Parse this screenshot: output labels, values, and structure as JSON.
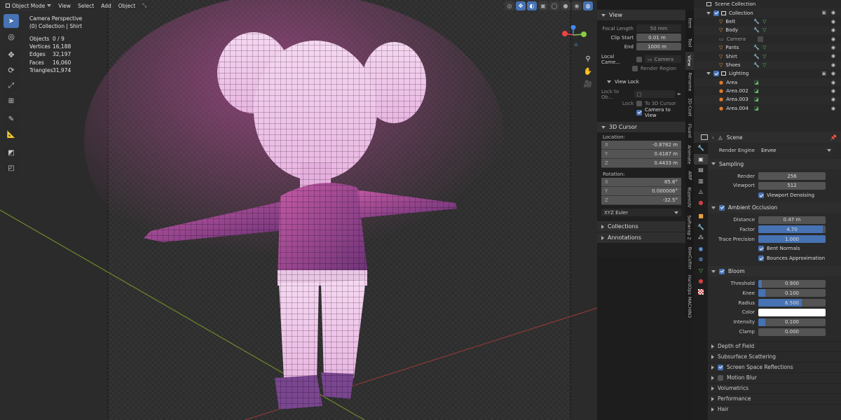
{
  "viewport": {
    "mode_label": "Object Mode",
    "menu": [
      "View",
      "Select",
      "Add",
      "Object"
    ],
    "overlay_title": "Camera Perspective",
    "overlay_collection": "(0) Collection | Shirt",
    "stats": [
      {
        "label": "Objects",
        "value": "0 / 9"
      },
      {
        "label": "Vertices",
        "value": "16,188"
      },
      {
        "label": "Edges",
        "value": "32,197"
      },
      {
        "label": "Faces",
        "value": "16,060"
      },
      {
        "label": "Triangles",
        "value": "31,974"
      }
    ]
  },
  "npanel": {
    "view_title": "View",
    "focal_length_label": "Focal Length",
    "focal_length_value": "50 mm",
    "clip_start_label": "Clip Start",
    "clip_start_value": "0.01 m",
    "clip_end_label": "End",
    "clip_end_value": "1000 m",
    "local_camera_label": "Local Came...",
    "local_camera_value": "Camera",
    "render_region_label": "Render Region",
    "view_lock_title": "View Lock",
    "lock_to_obj_label": "Lock to Ob...",
    "lock_label": "Lock",
    "to_3d_cursor_label": "To 3D Cursor",
    "camera_to_view_label": "Camera to View",
    "cursor_title": "3D Cursor",
    "location_label": "Location:",
    "location": [
      {
        "axis": "X",
        "value": "-0.8782 m"
      },
      {
        "axis": "Y",
        "value": "0.4187 m"
      },
      {
        "axis": "Z",
        "value": "0.4433 m"
      }
    ],
    "rotation_label": "Rotation:",
    "rotation": [
      {
        "axis": "X",
        "value": "85.6°"
      },
      {
        "axis": "Y",
        "value": "0.000006°"
      },
      {
        "axis": "Z",
        "value": "-32.5°"
      }
    ],
    "rotation_mode": "XYZ Euler",
    "collections_title": "Collections",
    "annotations_title": "Annotations"
  },
  "tabs": [
    "Item",
    "Tool",
    "View",
    "Rename",
    "3D-Coat",
    "Fluent",
    "Animate",
    "ARP",
    "RizomUV",
    "Softwrap 2",
    "BoxCutter",
    "HardOps",
    "MACHIN3"
  ],
  "outliner": {
    "title": "Scene Collection",
    "collection": "Collection",
    "items": [
      "Belt",
      "Body",
      "Camera",
      "Pants",
      "Shirt",
      "Shoes"
    ],
    "lighting": "Lighting",
    "lights": [
      "Area",
      "Area.002",
      "Area.003",
      "Area.004"
    ]
  },
  "properties": {
    "scene_label": "Scene",
    "render_engine_label": "Render Engine",
    "render_engine_value": "Eevee",
    "sampling_title": "Sampling",
    "render_label": "Render",
    "render_value": "256",
    "viewport_label": "Viewport",
    "viewport_value": "512",
    "viewport_denoising_label": "Viewport Denoising",
    "ao_title": "Ambient Occlusion",
    "distance_label": "Distance",
    "distance_value": "0.47 m",
    "factor_label": "Factor",
    "factor_value": "4.70",
    "factor_fraction": 0.96,
    "trace_label": "Trace Precision",
    "trace_value": "1.000",
    "trace_fraction": 1.0,
    "bent_normals_label": "Bent Normals",
    "bounces_label": "Bounces Approximation",
    "bloom_title": "Bloom",
    "threshold_label": "Threshold",
    "threshold_value": "0.900",
    "threshold_fraction": 0.05,
    "knee_label": "Knee",
    "knee_value": "0.100",
    "knee_fraction": 0.1,
    "radius_label": "Radius",
    "radius_value": "6.500",
    "radius_fraction": 0.65,
    "color_label": "Color",
    "color_value": "#ffffff",
    "intensity_label": "Intensity",
    "intensity_value": "0.100",
    "intensity_fraction": 0.1,
    "clamp_label": "Clamp",
    "clamp_value": "0.000",
    "sub_sections": [
      {
        "label": "Depth of Field",
        "checkbox": null
      },
      {
        "label": "Subsurface Scattering",
        "checkbox": null
      },
      {
        "label": "Screen Space Reflections",
        "checkbox": true
      },
      {
        "label": "Motion Blur",
        "checkbox": false
      },
      {
        "label": "Volumetrics",
        "checkbox": null
      },
      {
        "label": "Performance",
        "checkbox": null
      },
      {
        "label": "Hair",
        "checkbox": null
      }
    ]
  },
  "colors": {
    "accent": "#4772b3",
    "mesh_icon": "#e8a040",
    "light_icon": "#e07a2b",
    "data_icon": "#5ec06a",
    "collection_icon": "#dddddd"
  }
}
